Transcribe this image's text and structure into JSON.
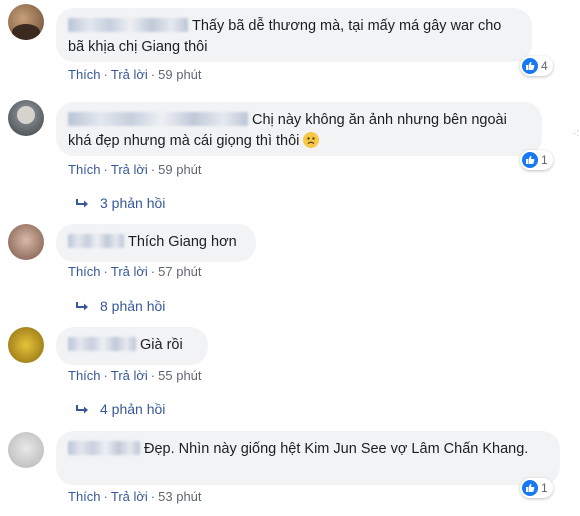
{
  "comments": [
    {
      "text": "Thấy bã dễ thương mà, tại mấy má gây war cho bã khịa chị Giang thôi",
      "like": "Thích",
      "reply": "Trả lời",
      "time": "59 phút",
      "reaction_count": "4",
      "replies": null
    },
    {
      "text": "Chị này không ăn ảnh nhưng bên ngoài khá đẹp nhưng mà cái giọng thì thôi",
      "like": "Thích",
      "reply": "Trả lời",
      "time": "59 phút",
      "reaction_count": "1",
      "replies": "3 phản hồi"
    },
    {
      "text": "Thích Giang hơn",
      "like": "Thích",
      "reply": "Trả lời",
      "time": "57 phút",
      "reaction_count": null,
      "replies": "8 phản hồi"
    },
    {
      "text": "Già rồi",
      "like": "Thích",
      "reply": "Trả lời",
      "time": "55 phút",
      "reaction_count": null,
      "replies": "4 phản hồi"
    },
    {
      "text": "Đẹp. Nhìn này giống hệt Kim Jun See vợ Lâm Chấn Khang.",
      "like": "Thích",
      "reply": "Trả lời",
      "time": "53 phút",
      "reaction_count": "1",
      "replies": null
    }
  ],
  "icons": {
    "like": "thumbs-up-icon",
    "reply_arrow": "reply-arrow-icon",
    "emoji": "slightly-frowning-face-icon",
    "more": "more-options-icon"
  },
  "colors": {
    "bubble_bg": "#f2f3f5",
    "link": "#385898",
    "meta": "#606770",
    "like_blue": "#1877f2"
  }
}
